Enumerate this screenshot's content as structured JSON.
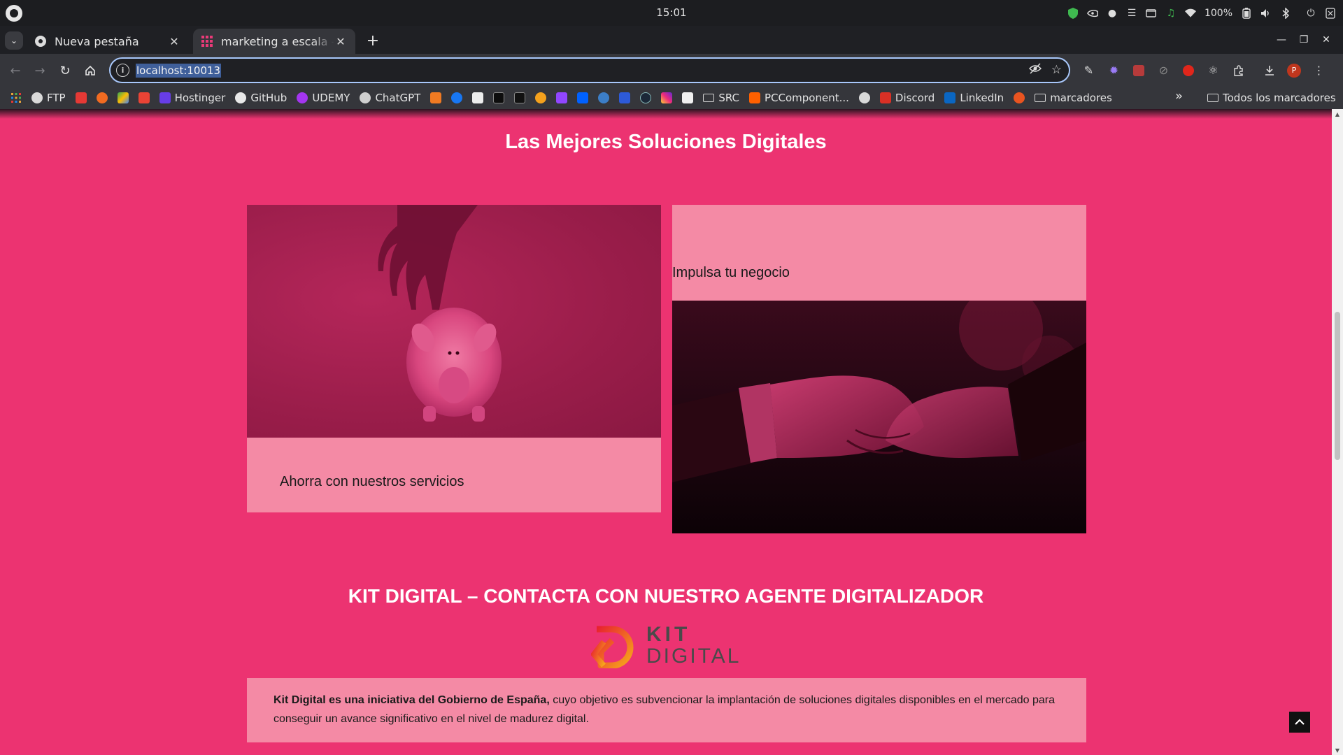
{
  "system": {
    "clock": "15:01",
    "battery": "100%"
  },
  "tabs": [
    {
      "title": "Nueva pestaña",
      "active": false
    },
    {
      "title": "marketing a escala – So",
      "active": true
    }
  ],
  "toolbar": {
    "url": "localhost:10013"
  },
  "bookmarks": {
    "items": [
      {
        "label": "FTP"
      },
      {
        "label": "Hostinger"
      },
      {
        "label": "GitHub"
      },
      {
        "label": "UDEMY"
      },
      {
        "label": "ChatGPT"
      },
      {
        "label": "SRC"
      },
      {
        "label": "PCComponent..."
      },
      {
        "label": "Discord"
      },
      {
        "label": "LinkedIn"
      },
      {
        "label": "marcadores"
      }
    ],
    "more": "»",
    "all_label": "Todos los marcadores"
  },
  "page": {
    "solutions_heading": "Las Mejores Soluciones Digitales",
    "card_save_caption": "Ahorra con nuestros servicios",
    "card_boost_caption": "Impulsa tu negocio",
    "kit_heading": "KIT DIGITAL – CONTACTA CON NUESTRO AGENTE DIGITALIZADOR",
    "kit_logo_line1": "KIT",
    "kit_logo_line2": "DIGITAL",
    "kit_text_bold": "Kit Digital es una iniciativa del Gobierno de España,",
    "kit_text_rest": " cuyo objetivo es subvencionar la implantación de soluciones digitales disponibles en el mercado para conseguir un avance significativo en el nivel de madurez digital."
  },
  "colors": {
    "page_bg": "#ec3371",
    "card_light": "#f48aa5",
    "browser_dark": "#1f2024",
    "toolbar": "#35363b"
  }
}
